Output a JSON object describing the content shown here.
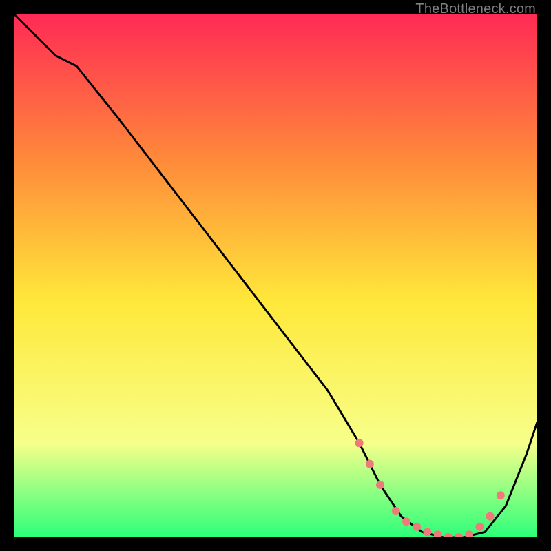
{
  "attribution": "TheBottleneck.com",
  "chart_data": {
    "type": "line",
    "title": "",
    "xlabel": "",
    "ylabel": "",
    "xlim": [
      0,
      100
    ],
    "ylim": [
      0,
      100
    ],
    "grid": false,
    "legend": false,
    "background_gradient": {
      "top": "#ff2a55",
      "upper_mid": "#ff8a3a",
      "mid": "#ffe83a",
      "lower_mid": "#f7ff8a",
      "bottom": "#2cff7a"
    },
    "series": [
      {
        "name": "bottleneck-curve",
        "color": "#000000",
        "x": [
          0,
          8,
          12,
          20,
          30,
          40,
          50,
          60,
          66,
          70,
          74,
          78,
          82,
          86,
          90,
          94,
          98,
          100
        ],
        "y": [
          100,
          92,
          90,
          80,
          67,
          54,
          41,
          28,
          18,
          10,
          4,
          1,
          0,
          0,
          1,
          6,
          16,
          22
        ]
      }
    ],
    "markers": {
      "name": "highlight-dots",
      "color": "#ef7a7a",
      "x": [
        66,
        68,
        70,
        73,
        75,
        77,
        79,
        81,
        83,
        85,
        87,
        89,
        91,
        93
      ],
      "y": [
        18,
        14,
        10,
        5,
        3,
        2,
        1,
        0.5,
        0,
        0,
        0.5,
        2,
        4,
        8
      ]
    }
  }
}
